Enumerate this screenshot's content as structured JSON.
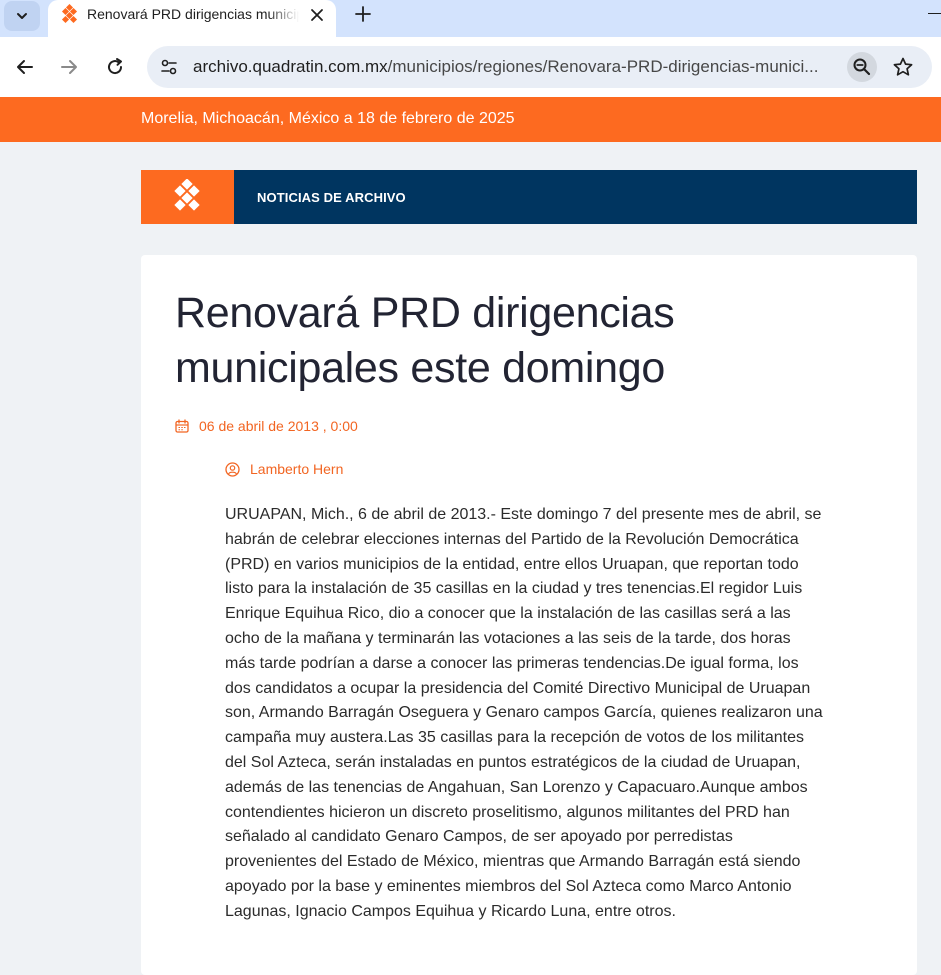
{
  "browser": {
    "tab_title": "Renovará PRD dirigencias municipales este domingo",
    "url_host": "archivo.quadratin.com.mx",
    "url_path": "/municipios/regiones/Renovara-PRD-dirigencias-munici..."
  },
  "icons": {
    "tab_menu": "chevron-down-icon",
    "favicon": "quadratin-logo-icon",
    "close": "close-icon",
    "new_tab": "plus-icon",
    "back": "arrow-left-icon",
    "forward": "arrow-right-icon",
    "reload": "reload-icon",
    "site_info": "tune-icon",
    "zoom": "zoom-out-icon",
    "bookmark": "star-icon",
    "calendar": "calendar-icon",
    "author": "user-icon"
  },
  "colors": {
    "brand_orange": "#fd6a20",
    "brand_navy": "#003560",
    "meta_orange": "#f26522"
  },
  "site": {
    "date_line": "Morelia, Michoacán, México a 18 de febrero de 2025",
    "section_label": "NOTICIAS DE ARCHIVO"
  },
  "article": {
    "title": "Renovará PRD dirigencias municipales este domingo",
    "date": "06 de abril de 2013 , 0:00",
    "author": "Lamberto Hern",
    "body": "URUAPAN, Mich., 6 de abril de 2013.- Este domingo 7 del presente mes de abril, se habrán de celebrar elecciones internas del Partido de la Revolución Democrática (PRD) en varios municipios de la entidad, entre ellos Uruapan, que reportan todo listo para la instalación de 35 casillas en la ciudad y tres tenencias.El regidor Luis Enrique Equihua Rico, dio a conocer que la instalación de las casillas será a las ocho de la mañana y terminarán las votaciones a las seis de la tarde, dos horas más tarde podrían a darse a conocer las primeras tendencias.De igual forma, los dos candidatos a ocupar la presidencia del Comité Directivo Municipal de Uruapan son, Armando Barragán Oseguera y Genaro campos García, quienes realizaron una campaña muy austera.Las 35 casillas para la recepción de votos de los militantes del Sol Azteca, serán instaladas en puntos estratégicos de la ciudad de Uruapan, además de las tenencias de Angahuan, San Lorenzo y Capacuaro.Aunque ambos contendientes hicieron un discreto proselitismo, algunos militantes del PRD han señalado al candidato Genaro Campos, de ser apoyado por perredistas provenientes del Estado de México, mientras que Armando Barragán está siendo apoyado por la base y eminentes miembros del Sol Azteca como Marco Antonio Lagunas, Ignacio Campos Equihua y Ricardo Luna, entre otros."
  }
}
